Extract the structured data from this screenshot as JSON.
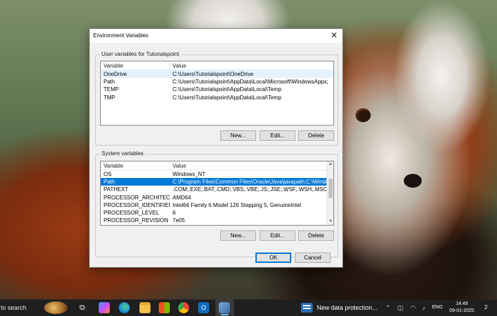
{
  "dialog": {
    "title": "Environment Variables",
    "close_glyph": "✕",
    "user_vars": {
      "group_label": "User variables for Tutorialspoint",
      "columns": [
        "Variable",
        "Value"
      ],
      "rows": [
        {
          "variable": "OneDrive",
          "value": "C:\\Users\\Tutorialspoint\\OneDrive"
        },
        {
          "variable": "Path",
          "value": "C:\\Users\\Tutorialspoint\\AppData\\Local\\Microsoft\\WindowsApps;"
        },
        {
          "variable": "TEMP",
          "value": "C:\\Users\\Tutorialspoint\\AppData\\Local\\Temp"
        },
        {
          "variable": "TMP",
          "value": "C:\\Users\\Tutorialspoint\\AppData\\Local\\Temp"
        }
      ],
      "buttons": {
        "new": "New...",
        "edit": "Edit...",
        "delete": "Delete"
      }
    },
    "system_vars": {
      "group_label": "System variables",
      "columns": [
        "Variable",
        "Value"
      ],
      "rows": [
        {
          "variable": "OS",
          "value": "Windows_NT"
        },
        {
          "variable": "Path",
          "value": "C:\\Program Files\\Common Files\\Oracle\\Java\\javapath;C:\\Windows..."
        },
        {
          "variable": "PATHEXT",
          "value": ".COM;.EXE;.BAT;.CMD;.VBS;.VBE;.JS;.JSE;.WSF;.WSH;.MSC"
        },
        {
          "variable": "PROCESSOR_ARCHITECTURE",
          "value": "AMD64"
        },
        {
          "variable": "PROCESSOR_IDENTIFIER",
          "value": "Intel64 Family 6 Model 126 Stepping 5, GenuineIntel"
        },
        {
          "variable": "PROCESSOR_LEVEL",
          "value": "6"
        },
        {
          "variable": "PROCESSOR_REVISION",
          "value": "7e05"
        }
      ],
      "selected_row": 1,
      "buttons": {
        "new": "New...",
        "edit": "Edit...",
        "delete": "Delete"
      }
    },
    "ok_label": "OK",
    "cancel_label": "Cancel"
  },
  "taskbar": {
    "search_text": "to search",
    "news_text": "New data protection...",
    "language": "ENG",
    "time": "14:49",
    "date": "09-01-2025",
    "notification_count": "2",
    "icons": [
      "task-view-icon",
      "copilot-icon",
      "edge-icon",
      "file-explorer-icon",
      "store-icon",
      "chrome-icon",
      "outlook-icon",
      "control-panel-icon"
    ],
    "colors": {
      "accent": "#0078d7",
      "taskbar_bg": "#1f1f1f"
    }
  }
}
